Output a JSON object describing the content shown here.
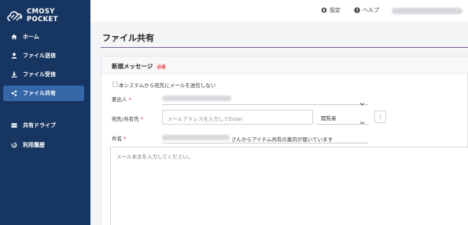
{
  "app": {
    "logo_line1": "CMOSY",
    "logo_line2": "POCKET"
  },
  "sidebar": {
    "items": [
      {
        "label": "ホーム",
        "icon": "home-icon",
        "active": false
      },
      {
        "label": "ファイル送信",
        "icon": "user-icon",
        "active": false
      },
      {
        "label": "ファイル受信",
        "icon": "download-icon",
        "active": false
      },
      {
        "label": "ファイル共有",
        "icon": "share-icon",
        "active": true
      },
      {
        "label": "共有ドライブ",
        "icon": "drive-icon",
        "active": false
      },
      {
        "label": "利用履歴",
        "icon": "history-icon",
        "active": false
      }
    ]
  },
  "header": {
    "settings_label": "設定",
    "help_label": "ヘルプ"
  },
  "page": {
    "title": "ファイル共有"
  },
  "form": {
    "section_title": "新規メッセージ",
    "required_badge": "必須",
    "no_notify_label": "本システムから宛先にメールを送信しない",
    "sender_label": "差出人",
    "recipient_label": "宛先/共有先",
    "recipient_placeholder": "メールアドレスを入力してEnter",
    "role_value": "閲覧者",
    "more_label": "⋮",
    "subject_label": "件名",
    "subject_suffix": "さんからアイテム共有の案内が届いています",
    "body_placeholder": "メール本文を入力してください。",
    "required_mark": "*"
  },
  "colors": {
    "sidebar_bg": "#163560",
    "sidebar_active": "#3466a8",
    "accent_line": "#7a5ca3",
    "required": "#dd3333"
  }
}
